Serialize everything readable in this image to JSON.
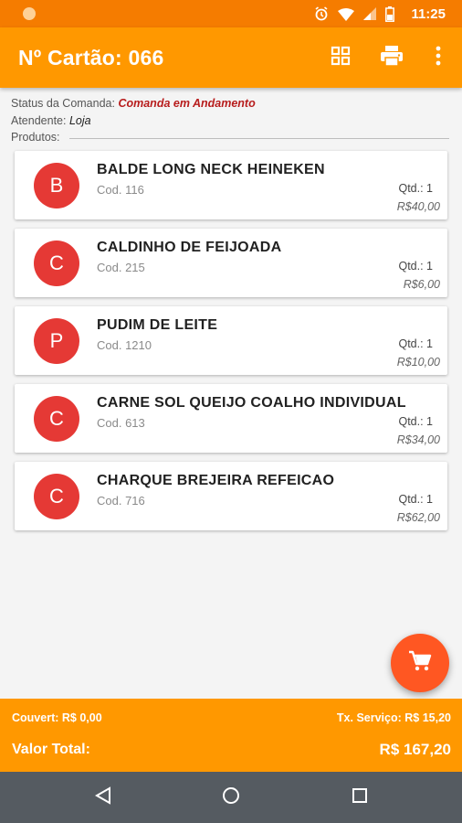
{
  "status_bar": {
    "time": "11:25",
    "icons": [
      "alarm-icon",
      "wifi-icon",
      "signal-icon",
      "battery-icon"
    ]
  },
  "app_bar": {
    "title": "Nº Cartão: 066",
    "actions": [
      "grid-icon",
      "print-icon",
      "more-vert-icon"
    ]
  },
  "info": {
    "status_label": "Status da Comanda:",
    "status_value": "Comanda em Andamento",
    "attendant_label": "Atendente:",
    "attendant_value": "Loja",
    "products_label": "Produtos:"
  },
  "products": [
    {
      "initial": "B",
      "name": "BALDE LONG NECK HEINEKEN",
      "code": "Cod. 116",
      "qty": "Qtd.: 1",
      "price": "R$40,00"
    },
    {
      "initial": "C",
      "name": "CALDINHO DE FEIJOADA",
      "code": "Cod. 215",
      "qty": "Qtd.: 1",
      "price": "R$6,00"
    },
    {
      "initial": "P",
      "name": "PUDIM DE LEITE",
      "code": "Cod. 1210",
      "qty": "Qtd.: 1",
      "price": "R$10,00"
    },
    {
      "initial": "C",
      "name": "CARNE SOL QUEIJO COALHO INDIVIDUAL",
      "code": "Cod. 613",
      "qty": "Qtd.: 1",
      "price": "R$34,00"
    },
    {
      "initial": "C",
      "name": "CHARQUE BREJEIRA REFEICAO",
      "code": "Cod. 716",
      "qty": "Qtd.: 1",
      "price": "R$62,00"
    }
  ],
  "footer": {
    "couvert": "Couvert: R$ 0,00",
    "service_fee": "Tx. Serviço: R$ 15,20",
    "total_label": "Valor Total:",
    "total_value": "R$ 167,20"
  },
  "colors": {
    "primary": "#ff9800",
    "status_bar": "#f57c00",
    "avatar": "#e53935",
    "fab": "#ff5722",
    "status_value": "#b71c1c"
  }
}
